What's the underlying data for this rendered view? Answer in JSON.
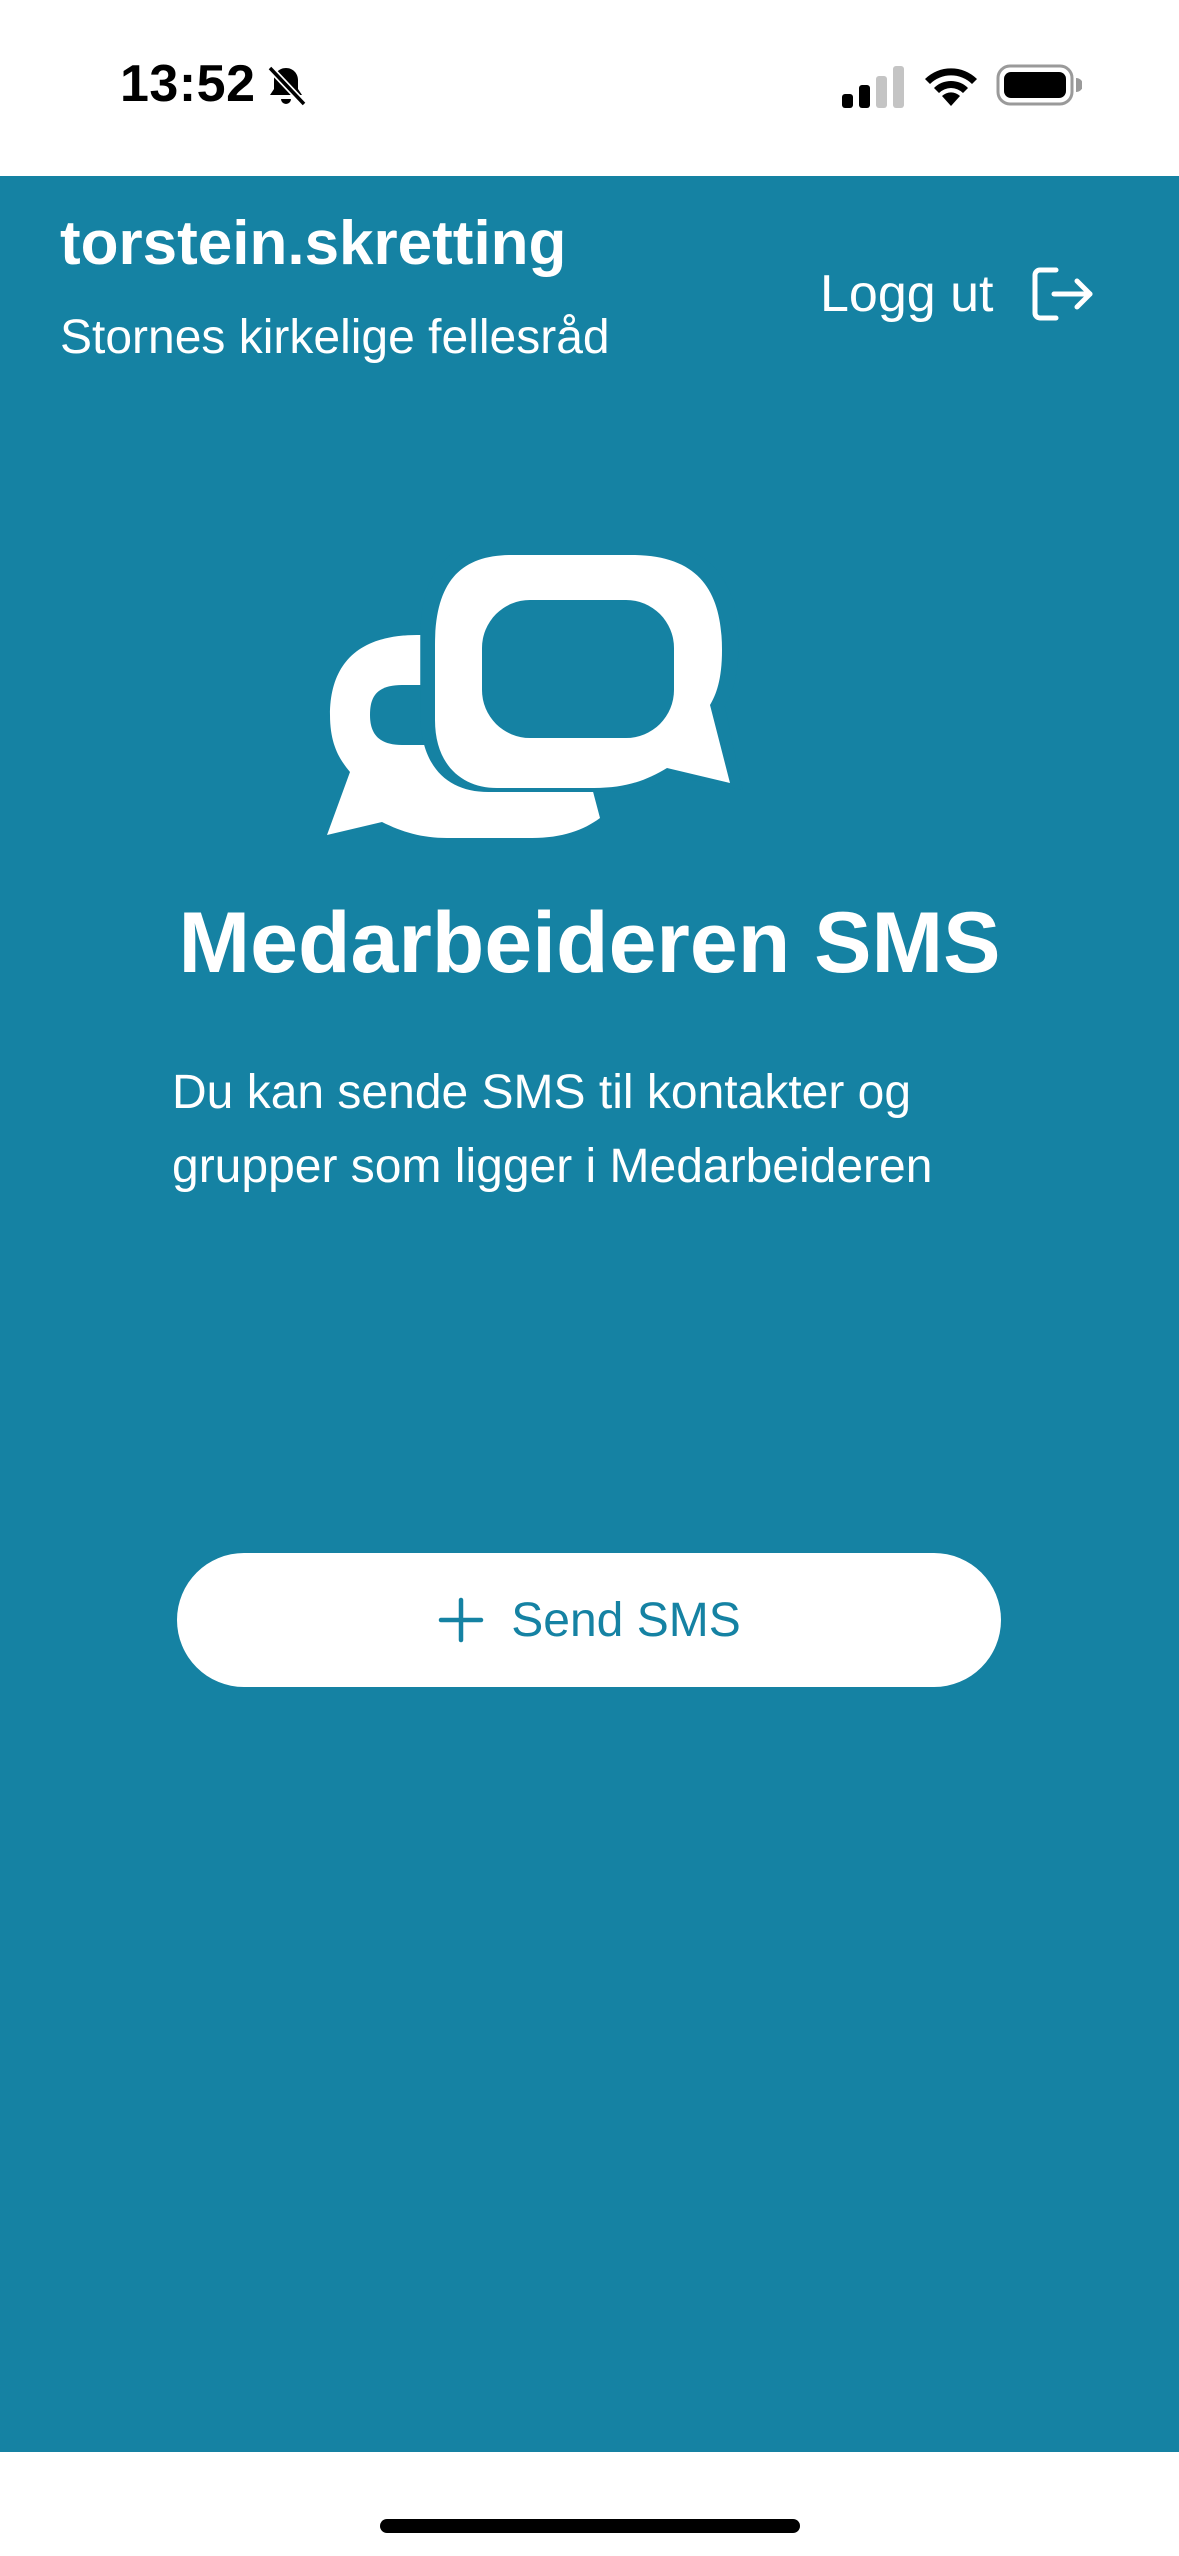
{
  "status_bar": {
    "time": "13:52",
    "icons": [
      "bell-slash-icon",
      "signal-icon",
      "wifi-icon",
      "battery-icon"
    ]
  },
  "header": {
    "user_name": "torstein.skretting",
    "organization": "Stornes kirkelige fellesråd",
    "logout_label": "Logg ut",
    "logout_icon": "logout-icon"
  },
  "main": {
    "logo_icon": "chat-bubbles-icon",
    "title": "Medarbeideren SMS",
    "description": "Du kan sende SMS til kontakter og grupper som ligger i Medarbeideren",
    "send_button_label": "Send SMS",
    "send_button_icon": "plus-icon"
  },
  "colors": {
    "primary": "#1582a3",
    "background_top": "#ffffff",
    "text_on_primary": "#ffffff"
  }
}
